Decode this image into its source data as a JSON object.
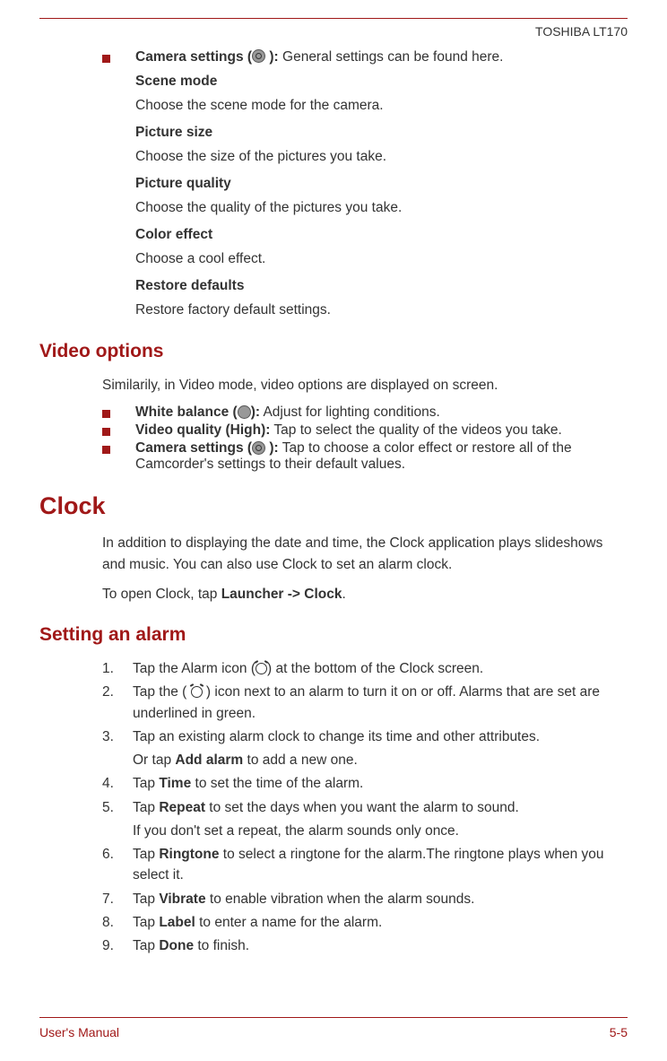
{
  "header": "TOSHIBA LT170",
  "camera": {
    "settings_label": "Camera settings (",
    "settings_tail": " ): ",
    "settings_desc": "General settings can be found here.",
    "scene_h": "Scene mode",
    "scene_t": "Choose the scene mode for the camera.",
    "psize_h": "Picture size",
    "psize_t": "Choose the size of the pictures you take.",
    "pqual_h": "Picture quality",
    "pqual_t": "Choose the quality of the pictures you take.",
    "color_h": "Color effect",
    "color_t": "Choose a cool effect.",
    "restore_h": "Restore defaults",
    "restore_t": "Restore factory default settings."
  },
  "video": {
    "heading": "Video options",
    "intro": "Similarily, in Video mode, video options are displayed on screen.",
    "wb_b": "White balance (",
    "wb_tail": "):",
    "wb_t": " Adjust for lighting conditions.",
    "vq_b": "Video quality (High):",
    "vq_t": " Tap to select the quality of the videos you take.",
    "cs_b": "Camera settings (",
    "cs_tail": " ):",
    "cs_t": " Tap to choose a color effect or restore all of the Camcorder's settings to their default values."
  },
  "clock": {
    "heading": "Clock",
    "intro1": "In addition to displaying the date and time, the Clock application plays slideshows and music. You can also use Clock to set an alarm clock.",
    "intro2a": "To open Clock, tap ",
    "intro2b": "Launcher -> Clock",
    "intro2c": "."
  },
  "alarm": {
    "heading": "Setting an alarm",
    "s1a": "Tap the Alarm icon (",
    "s1b": ") at the bottom of the Clock screen.",
    "s2a": "Tap the ( ",
    "s2b": " ) icon next to an alarm to turn it on or off. Alarms that are set are underlined in green.",
    "s3": "Tap an existing alarm clock to change its time and other attributes.",
    "s3c_a": "Or tap ",
    "s3c_b": "Add alarm",
    "s3c_c": " to add a new one.",
    "s4a": "Tap ",
    "s4b": "Time",
    "s4c": " to set the time of the alarm.",
    "s5a": "Tap ",
    "s5b": "Repeat",
    "s5c": " to set the days when you want the alarm to sound.",
    "s5d": "If you don't set a repeat, the alarm sounds only once.",
    "s6a": "Tap ",
    "s6b": "Ringtone",
    "s6c": " to select a ringtone for the alarm.The ringtone plays when you select it.",
    "s7a": "Tap ",
    "s7b": "Vibrate",
    "s7c": " to enable vibration when the alarm sounds.",
    "s8a": "Tap ",
    "s8b": "Label",
    "s8c": " to enter a name for the alarm.",
    "s9a": "Tap ",
    "s9b": "Done",
    "s9c": " to finish.",
    "nums": [
      "1.",
      "2.",
      "3.",
      "4.",
      "5.",
      "6.",
      "7.",
      "8.",
      "9."
    ]
  },
  "footer": {
    "left": "User's Manual",
    "right": "5-5"
  }
}
